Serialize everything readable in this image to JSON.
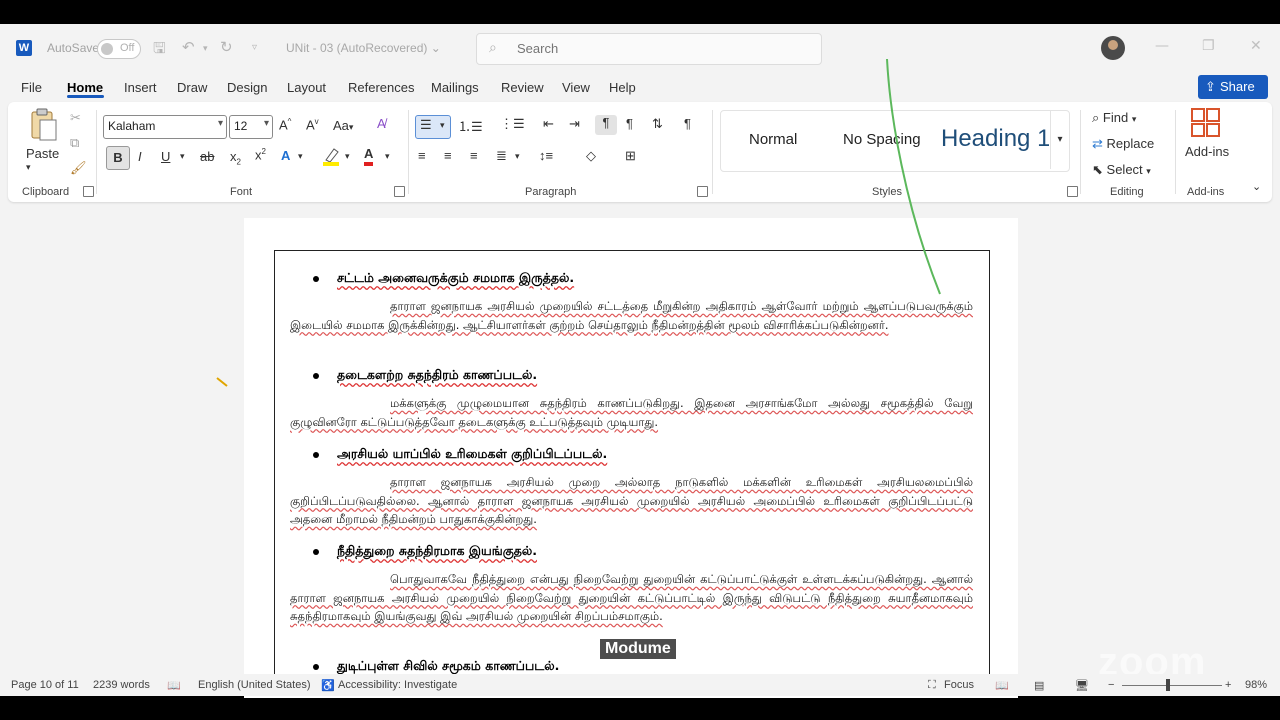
{
  "titlebar": {
    "autosave_label": "AutoSave",
    "autosave_state": "Off",
    "doc_title": "UNit - 03 (AutoRecovered)",
    "search_placeholder": "Search"
  },
  "menu": [
    "File",
    "Home",
    "Insert",
    "Draw",
    "Design",
    "Layout",
    "References",
    "Mailings",
    "Review",
    "View",
    "Help"
  ],
  "active_menu": "Home",
  "share_label": "Share",
  "ribbon": {
    "clipboard": {
      "paste_label": "Paste",
      "group_label": "Clipboard"
    },
    "font": {
      "font_name": "Kalaham",
      "font_size": "12",
      "group_label": "Font",
      "case_label": "Aa"
    },
    "paragraph": {
      "group_label": "Paragraph"
    },
    "styles": {
      "items": [
        "Normal",
        "No Spacing",
        "Heading 1"
      ],
      "group_label": "Styles"
    },
    "editing": {
      "find": "Find",
      "replace": "Replace",
      "select": "Select",
      "group_label": "Editing"
    },
    "addins": {
      "label": "Add-ins",
      "group_label": "Add-ins"
    }
  },
  "document": {
    "sections": [
      {
        "heading": "சட்டம் அனைவருக்கும் சமமாக இருத்தல்.",
        "body": "தாராள ஜனநாயக அரசியல் முறையில் சட்டத்தை மீறுகின்ற அதிகாரம் ஆள்வோர் மற்றும் ஆளப்படுபவருக்கும் இடையில் சமமாக இருக்கின்றது. ஆட்சியாளர்கள் குற்றம் செய்தாலும் நீதிமன்றத்தின் மூலம் விசாரிக்கப்படுகின்றனர்."
      },
      {
        "heading": "தடைகளற்ற சுதந்திரம் காணப்படல்.",
        "body": "மக்களுக்கு முழுமையான சுதந்திரம் காணப்படுகிறது. இதனை அரசாங்கமோ அல்லது சமூகத்தில் வேறு குழுவினரோ கட்டுப்படுத்தவோ தடைகளுக்கு உட்படுத்தவும் முடியாது."
      },
      {
        "heading": "அரசியல் யாப்பில் உரிமைகள் குறிப்பிடப்படல்.",
        "body": "தாராள ஜனநாயக அரசியல் முறை அல்லாத நாடுகளில் மக்களின் உரிமைகள் அரசியலமைப்பில் குறிப்பிடப்படுவதில்லை. ஆனால் தாராள ஜனநாயக அரசியல் முறையில் அரசியல் அமைப்பில் உரிமைகள் குறிப்பிடப்பட்டு அதனை மீறாமல் நீதிமன்றம் பாதுகாக்குகின்றது."
      },
      {
        "heading": "நீதித்துறை சுதந்திரமாக இயங்குதல்.",
        "body": "பொதுவாகவே நீதித்துறை என்பது நிறைவேற்று துறையின் கட்டுப்பாட்டுக்குள் உள்ளடக்கப்படுகின்றது. ஆனால் தாராள ஜனநாயக அரசியல் முறையில் நிறைவேற்று துறையின் கட்டுப்பாட்டில் இருந்து விடுபட்டு நீதித்துறை சுயாதீனமாகவும் சுதந்திரமாகவும் இயங்குவது இவ் அரசியல் முறையின் சிறப்பம்சமாகும்."
      },
      {
        "heading": "துடிப்புள்ள சிவில் சமூகம் காணப்படல்.",
        "body": ""
      }
    ],
    "overlay_label": "Modume",
    "watermark": "zoom"
  },
  "statusbar": {
    "page": "Page 10 of 11",
    "words": "2239 words",
    "language": "English (United States)",
    "accessibility": "Accessibility: Investigate",
    "focus": "Focus",
    "zoom": "98%"
  },
  "colors": {
    "accent": "#185abd",
    "ribbon_bg": "#ffffff",
    "app_bg": "#f3f3f3"
  }
}
